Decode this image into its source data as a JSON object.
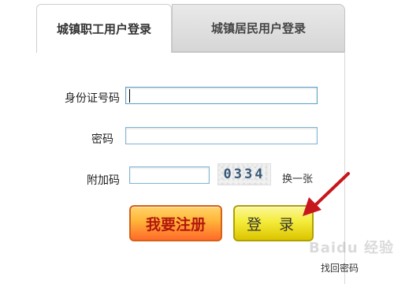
{
  "tabs": [
    {
      "label": "城镇职工用户登录",
      "active": true
    },
    {
      "label": "城镇居民用户登录",
      "active": false
    }
  ],
  "form": {
    "id_label": "身份证号码",
    "id_value": "",
    "password_label": "密码",
    "password_value": "",
    "captcha_label": "附加码",
    "captcha_value": "",
    "captcha_image_text": "0334",
    "refresh_label": "换一张"
  },
  "buttons": {
    "register": "我要注册",
    "login": "登 录"
  },
  "links": {
    "forgot_password": "找回密码"
  },
  "watermark": "Baidu 经验",
  "colors": {
    "accent_field_border": "#7fb6d6",
    "register_button": "#ff6a2a",
    "login_button": "#f4ec3a",
    "arrow": "#c8161d"
  }
}
